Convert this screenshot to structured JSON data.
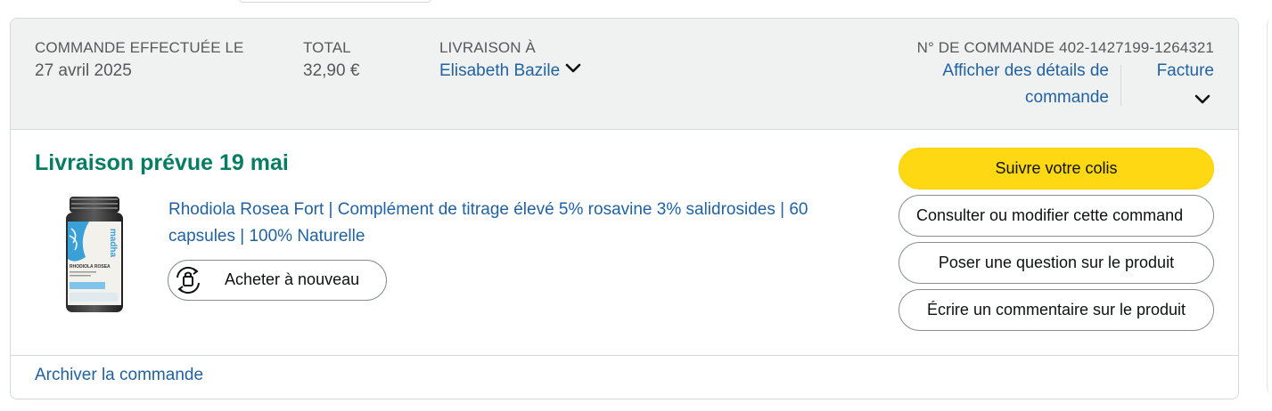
{
  "order_header": {
    "placed_label": "COMMANDE EFFECTUÉE LE",
    "placed_date": "27 avril 2025",
    "total_label": "TOTAL",
    "total_value": "32,90 €",
    "ship_to_label": "LIVRAISON À",
    "ship_to_name": "Elisabeth Bazile",
    "order_number_label": "N° DE COMMANDE 402-1427199-1264321",
    "order_details_link": "Afficher des détails de commande",
    "invoice_link": "Facture"
  },
  "shipment": {
    "delivery_status": "Livraison prévue 19 mai",
    "product_title": "Rhodiola Rosea Fort | Complément de titrage élevé 5% rosavine 3% salidrosides | 60 capsules | 100% Naturelle",
    "product_image": {
      "brand_text": "madha",
      "label_text": "RHODIOLA ROSEA"
    },
    "buy_again_label": "Acheter à nouveau"
  },
  "actions": {
    "track_package": "Suivre votre colis",
    "view_edit_order": "Consulter ou modifier cette command",
    "ask_question": "Poser une question sur le produit",
    "write_review": "Écrire un commentaire sur le produit"
  },
  "footer": {
    "archive_link": "Archiver la commande"
  },
  "icons": {
    "ship_to_dropdown": "chevron-down-icon",
    "invoice_dropdown": "chevron-down-icon",
    "buy_again": "buy-again-icon"
  },
  "colors": {
    "header_bg": "#f0f2f2",
    "link": "#2162a1",
    "delivery_status": "#067d62",
    "primary_button": "#ffd814",
    "border": "#d5d9d9"
  }
}
